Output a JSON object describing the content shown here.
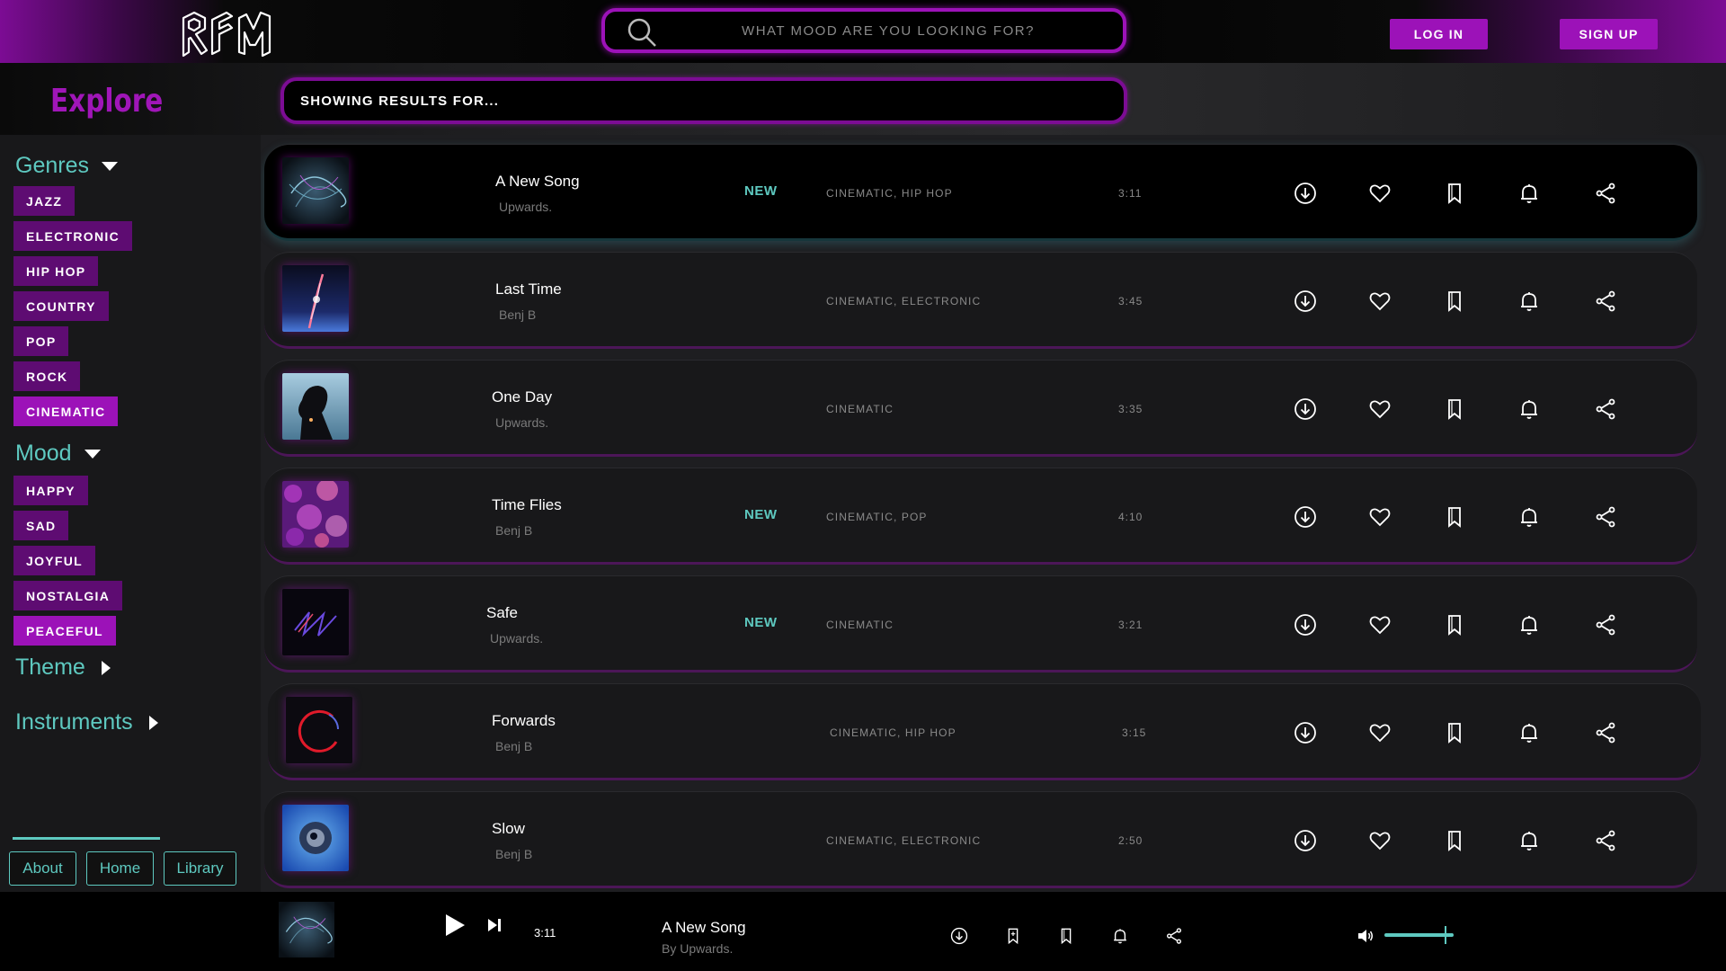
{
  "header": {
    "logo_text": "RFM",
    "search": {
      "placeholder": "WHAT MOOD ARE YOU LOOKING FOR?"
    },
    "login_label": "LOG IN",
    "signup_label": "SIGN UP",
    "accent_color": "#9c12b8"
  },
  "explore": {
    "title": "Explore",
    "results_label": "SHOWING RESULTS FOR..."
  },
  "sidebar": {
    "genres_label": "Genres",
    "genres": [
      {
        "label": "JAZZ",
        "active": false
      },
      {
        "label": "ELECTRONIC",
        "active": false
      },
      {
        "label": "HIP HOP",
        "active": false
      },
      {
        "label": "COUNTRY",
        "active": false
      },
      {
        "label": "POP",
        "active": false
      },
      {
        "label": "ROCK",
        "active": false
      },
      {
        "label": "CINEMATIC",
        "active": true
      }
    ],
    "mood_label": "Mood",
    "moods": [
      {
        "label": "HAPPY",
        "active": false
      },
      {
        "label": "SAD",
        "active": false
      },
      {
        "label": "JOYFUL",
        "active": false
      },
      {
        "label": "NOSTALGIA",
        "active": false
      },
      {
        "label": "PEACEFUL",
        "active": true
      }
    ],
    "theme_label": "Theme",
    "instruments_label": "Instruments",
    "footer_links": [
      "About",
      "Home",
      "Library"
    ],
    "teal_color": "#5ec9c0"
  },
  "songs": [
    {
      "title": "A New Song",
      "artist": "Upwards.",
      "new": "NEW",
      "genres": "CINEMATIC, HIP HOP",
      "duration": "3:11",
      "thumb": "thumb-swirl"
    },
    {
      "title": "Last Time",
      "artist": "Benj B",
      "new": "",
      "genres": "CINEMATIC, ELECTRONIC",
      "duration": "3:45",
      "thumb": "thumb-sparkler"
    },
    {
      "title": "One Day",
      "artist": "Upwards.",
      "new": "",
      "genres": "CINEMATIC",
      "duration": "3:35",
      "thumb": "thumb-silhouette"
    },
    {
      "title": "Time Flies",
      "artist": "Benj B",
      "new": "NEW",
      "genres": "CINEMATIC, POP",
      "duration": "4:10",
      "thumb": "thumb-bokeh"
    },
    {
      "title": "Safe",
      "artist": "Upwards.",
      "new": "NEW",
      "genres": "CINEMATIC",
      "duration": "3:21",
      "thumb": "thumb-neon-lines"
    },
    {
      "title": "Forwards",
      "artist": "Benj B",
      "new": "",
      "genres": "CINEMATIC, HIP HOP",
      "duration": "3:15",
      "thumb": "thumb-red-ring"
    },
    {
      "title": "Slow",
      "artist": "Benj B",
      "new": "",
      "genres": "CINEMATIC, ELECTRONIC",
      "duration": "2:50",
      "thumb": "thumb-blue-planet"
    }
  ],
  "row_actions": [
    "download-icon",
    "heart-icon",
    "bookmark-icon",
    "bell-icon",
    "share-icon"
  ],
  "player": {
    "time": "3:11",
    "title": "A New Song",
    "artist": "By Upwards.",
    "volume": 0.85,
    "actions": [
      "download-icon",
      "bookmark-add-icon",
      "bookmark-icon",
      "bell-icon",
      "share-icon"
    ]
  }
}
